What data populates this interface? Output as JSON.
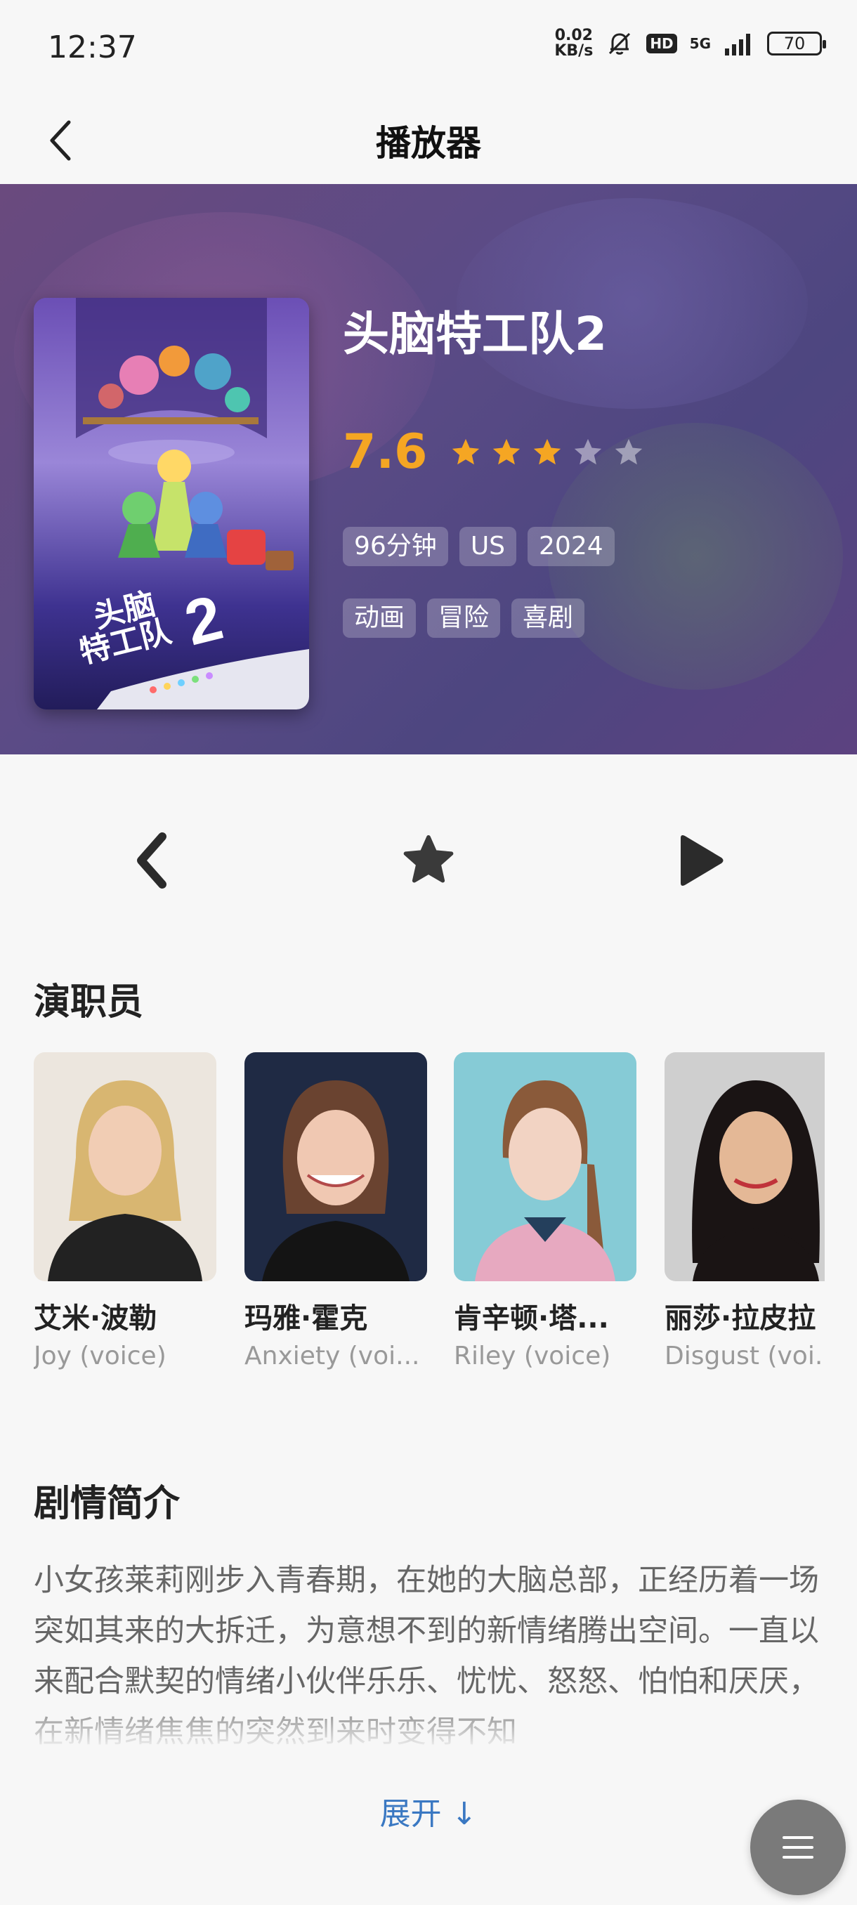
{
  "status_bar": {
    "time": "12:37",
    "net_speed_value": "0.02",
    "net_speed_unit": "KB/s",
    "hd_badge": "HD",
    "network": "5G",
    "battery": "70"
  },
  "header": {
    "title": "播放器"
  },
  "movie": {
    "title": "头脑特工队2",
    "rating": "7.6",
    "stars_filled": 3,
    "stars_total": 5,
    "meta_tags": [
      "96分钟",
      "US",
      "2024"
    ],
    "genre_tags": [
      "动画",
      "冒险",
      "喜剧"
    ],
    "poster_text_line1": "头脑",
    "poster_text_line2": "特工队",
    "poster_text_num": "2"
  },
  "cast_section": {
    "title": "演职员",
    "members": [
      {
        "name": "艾米·波勒",
        "role": "Joy (voice)"
      },
      {
        "name": "玛雅·霍克",
        "role": "Anxiety (voi..."
      },
      {
        "name": "肯辛顿·塔...",
        "role": "Riley (voice)"
      },
      {
        "name": "丽莎·拉皮拉",
        "role": "Disgust (voi..."
      }
    ]
  },
  "synopsis_section": {
    "title": "剧情简介",
    "text": "小女孩莱莉刚步入青春期，在她的大脑总部，正经历着一场突如其来的大拆迁，为意想不到的新情绪腾出空间。一直以来配合默契的情绪小伙伴乐乐、忧忧、怒怒、怕怕和厌厌，在新情绪焦焦的突然到来时变得不知",
    "expand_label": "展开 ↓"
  },
  "colors": {
    "accent_rating": "#f5a623",
    "link": "#3a78c2"
  }
}
